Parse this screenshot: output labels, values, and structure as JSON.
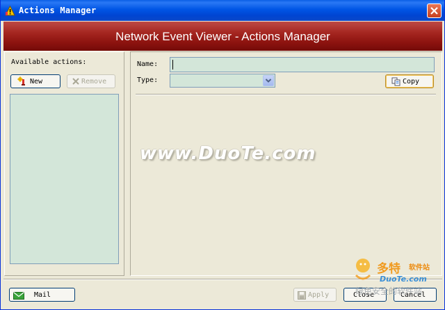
{
  "window": {
    "title": "Actions Manager"
  },
  "banner": {
    "title": "Network Event Viewer - Actions Manager"
  },
  "left": {
    "available_label": "Available actions:",
    "new_button": "New",
    "remove_button": "Remove",
    "actions_list": []
  },
  "right": {
    "name_label": "Name:",
    "name_value": "",
    "type_label": "Type:",
    "type_value": "",
    "copy_button": "Copy"
  },
  "footer": {
    "mail_button": "Mail",
    "apply_button": "Apply",
    "close_button": "Close",
    "cancel_button": "Cancel"
  },
  "watermark": {
    "text": "www.DuoTe.com",
    "logo_text": "多特",
    "logo_sub": "软件站",
    "logo_url": "DuoTe.com",
    "logo_cn": "绿色安全的软件站"
  },
  "colors": {
    "titlebar": "#0055e5",
    "banner": "#a4251f",
    "field_bg": "#d3e6d9",
    "window_bg": "#ece9d8"
  },
  "icons": {
    "app": "warning-icon",
    "close": "close-icon",
    "new": "new-action-icon",
    "remove": "remove-x-icon",
    "copy": "copy-icon",
    "mail": "mail-icon",
    "apply": "save-icon",
    "dropdown": "chevron-down-icon"
  }
}
